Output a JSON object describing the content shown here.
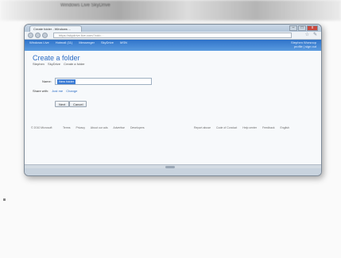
{
  "photo": {
    "top_caption": "Windows Live SkyDrive"
  },
  "browser": {
    "tab_title": "Create folder - Windows ...",
    "url": "https://skydrive.live.com/?cid=...",
    "window_controls": {
      "minimize": "–",
      "maximize": "□",
      "close": "x"
    },
    "icons": [
      "back-icon",
      "forward-icon",
      "refresh-icon",
      "star-icon",
      "wrench-icon"
    ]
  },
  "skydrive_header": {
    "nav": [
      "Windows Live",
      "Hotmail (11)",
      "Messenger",
      "SkyDrive",
      "MSN"
    ],
    "account_name": "Stephen Worsnop",
    "account_sub": "profile | sign out"
  },
  "page": {
    "title": "Create a folder",
    "breadcrumb": [
      "Stephen",
      "SkyDrive",
      "Create a folder"
    ],
    "name_label": "Name:",
    "name_value": "New folder",
    "share_label": "Share with:",
    "share_value": "Just me",
    "share_change": "Change",
    "next_button": "Next",
    "cancel_button": "Cancel"
  },
  "footer": {
    "copyright": "© 2010 Microsoft",
    "links_left": [
      "Terms",
      "Privacy",
      "About our ads",
      "Advertise",
      "Developers"
    ],
    "links_right": [
      "Report abuse",
      "Code of Conduct",
      "Help center",
      "Feedback",
      "English"
    ]
  },
  "colors": {
    "header_blue": "#2f73c9",
    "title_blue": "#2b6cc4",
    "selection_blue": "#3a7bd5"
  }
}
